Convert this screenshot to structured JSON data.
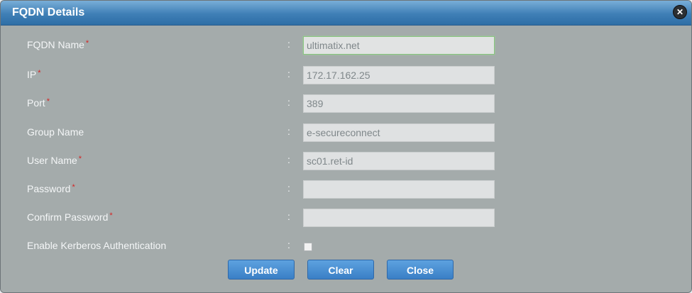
{
  "dialog": {
    "title": "FQDN Details"
  },
  "form": {
    "colon": ":",
    "required_mark": "*",
    "fields": {
      "fqdn_name": {
        "label": "FQDN Name",
        "value": "ultimatix.net"
      },
      "ip": {
        "label": "IP",
        "value": "172.17.162.25"
      },
      "port": {
        "label": "Port",
        "value": "389"
      },
      "group_name": {
        "label": "Group Name",
        "value": "e-secureconnect"
      },
      "user_name": {
        "label": "User Name",
        "value": "sc01.ret-id"
      },
      "password": {
        "label": "Password",
        "value": ""
      },
      "confirm_password": {
        "label": "Confirm Password",
        "value": ""
      },
      "kerberos": {
        "label": "Enable Kerberos Authentication",
        "checked": false
      }
    }
  },
  "buttons": {
    "update": "Update",
    "clear": "Clear",
    "close": "Close"
  },
  "icons": {
    "close": "close-icon"
  }
}
